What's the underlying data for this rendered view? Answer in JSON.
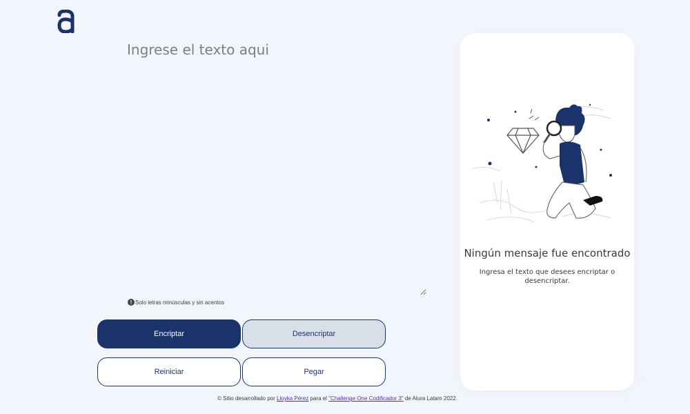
{
  "logo": {
    "icon": "alura-logo-icon",
    "color": "#1a336b"
  },
  "input": {
    "placeholder": "Ingrese el texto aqui",
    "value": ""
  },
  "hint": {
    "icon": "exclamation-icon",
    "text": "Solo letras minúsculas y sin acentos"
  },
  "buttons": {
    "encrypt": "Encriptar",
    "decrypt": "Desencriptar",
    "reset": "Reiniciar",
    "paste": "Pegar"
  },
  "output_panel": {
    "illustration": "boy-with-magnifying-glass-illustration",
    "title": "Ningún mensaje fue encontrado",
    "text": "Ingresa el texto que desees encriptar o desencriptar."
  },
  "footer": {
    "prefix": "© Sitio desarrollado por",
    "author": "Lloyka Pérez",
    "middle": "para el",
    "challenge": "\"Challenge One Codificador 3\"",
    "suffix": "de Alura Latam 2022."
  },
  "colors": {
    "accent": "#1a336b",
    "background": "#f3f5fc",
    "decrypt_bg": "#d8dfe8"
  }
}
